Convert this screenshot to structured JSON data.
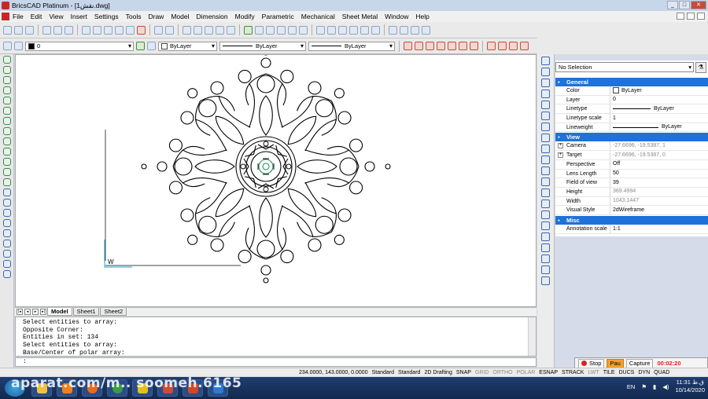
{
  "window": {
    "title": "BricsCAD Platinum - [نقش1.dwg]",
    "min": "_",
    "max": "□",
    "close": "✕"
  },
  "menu": [
    "File",
    "Edit",
    "View",
    "Insert",
    "Settings",
    "Tools",
    "Draw",
    "Model",
    "Dimension",
    "Modify",
    "Parametric",
    "Mechanical",
    "Sheet Metal",
    "Window",
    "Help"
  ],
  "layerbar": {
    "layer": "0",
    "color": "ByLayer",
    "linetype": "ByLayer",
    "lineweight": "ByLayer"
  },
  "tabs": [
    "Model",
    "Sheet1",
    "Sheet2"
  ],
  "command": {
    "lines": [
      "Select entities to array:",
      "Opposite Corner:",
      "Entities in set: 134",
      "Select entities to array:",
      "Base/Center of polar array:"
    ],
    "prompt": ":"
  },
  "status": {
    "coords": "234.0000, 143.0000, 0.0000",
    "items": [
      {
        "label": "Standard",
        "on": true
      },
      {
        "label": "Standard",
        "on": true
      },
      {
        "label": "2D Drafting",
        "on": true
      },
      {
        "label": "SNAP",
        "on": true
      },
      {
        "label": "GRID",
        "on": false
      },
      {
        "label": "ORTHO",
        "on": false
      },
      {
        "label": "POLAR",
        "on": false
      },
      {
        "label": "ESNAP",
        "on": true
      },
      {
        "label": "STRACK",
        "on": true
      },
      {
        "label": "LWT",
        "on": false
      },
      {
        "label": "TILE",
        "on": true
      },
      {
        "label": "DUCS",
        "on": true
      },
      {
        "label": "DYN",
        "on": true
      },
      {
        "label": "QUAD",
        "on": true
      }
    ]
  },
  "properties": {
    "selection": "No Selection",
    "sections": [
      {
        "name": "General",
        "rows": [
          {
            "label": "Color",
            "value": "ByLayer"
          },
          {
            "label": "Layer",
            "value": "0"
          },
          {
            "label": "Linetype",
            "value": "ByLayer"
          },
          {
            "label": "Linetype scale",
            "value": "1"
          },
          {
            "label": "Lineweight",
            "value": "ByLayer"
          }
        ]
      },
      {
        "name": "View",
        "rows": [
          {
            "label": "Camera",
            "value": "-27.6696, -19.5387, 1"
          },
          {
            "label": "Target",
            "value": "-27.6696, -19.5387, 0"
          },
          {
            "label": "Perspective",
            "value": "Off"
          },
          {
            "label": "Lens Length",
            "value": "50"
          },
          {
            "label": "Field of view",
            "value": "39"
          },
          {
            "label": "Height",
            "value": "369.4994"
          },
          {
            "label": "Width",
            "value": "1043.1447"
          },
          {
            "label": "Visual Style",
            "value": "2dWireframe"
          }
        ]
      },
      {
        "name": "Misc",
        "rows": [
          {
            "label": "Annotation scale",
            "value": "1:1"
          }
        ]
      }
    ]
  },
  "ucs": {
    "w": "W"
  },
  "recorder": {
    "stop": "Stop",
    "pause": "Pau",
    "capture": "Capture",
    "time": "00:02:20"
  },
  "tray": {
    "lang": "EN",
    "time": "11:31 ق.ظ",
    "date": "10/14/2020"
  },
  "watermark": "aparat.com/m.. soomeh.6165"
}
